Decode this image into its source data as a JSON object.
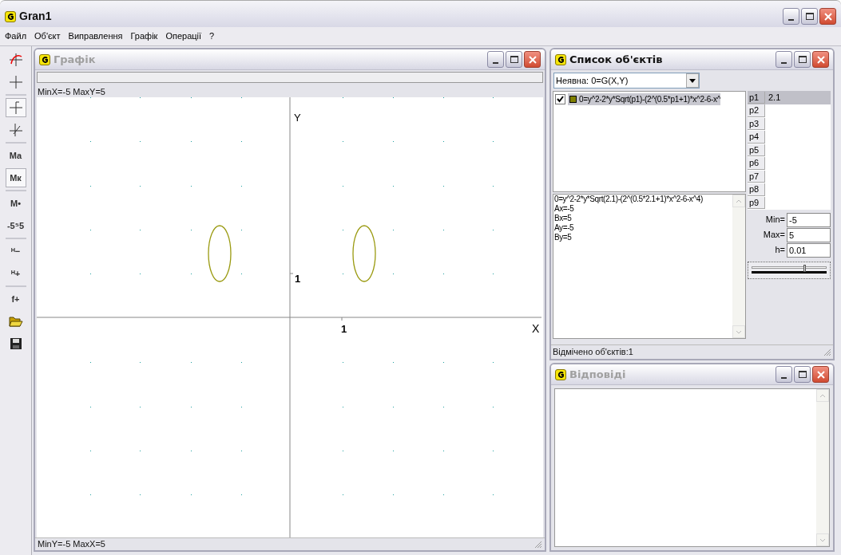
{
  "app": {
    "title": "Gran1",
    "menu": [
      "Файл",
      "Об'єкт",
      "Виправлення",
      "Графік",
      "Операції",
      "?"
    ]
  },
  "toolbar": [
    [
      {
        "kind": "axes-color",
        "selected": false
      },
      {
        "kind": "cross",
        "selected": false
      }
    ],
    [
      {
        "kind": "axes-up",
        "selected": true
      },
      {
        "kind": "axes-tilt",
        "selected": false
      }
    ],
    [
      {
        "kind": "label",
        "label": "Mа",
        "selected": false
      },
      {
        "kind": "label",
        "label": "Mк",
        "selected": true
      }
    ],
    [
      {
        "kind": "label",
        "label": "M•",
        "selected": false
      },
      {
        "kind": "label",
        "label": "-5⁵5",
        "selected": false
      }
    ],
    [
      {
        "kind": "label",
        "label": "ᴴ−",
        "selected": false
      },
      {
        "kind": "label",
        "label": "ᴴ+",
        "selected": false
      }
    ],
    [
      {
        "kind": "label",
        "label": "f+",
        "selected": false
      },
      {
        "kind": "open",
        "selected": false
      },
      {
        "kind": "save",
        "selected": false
      }
    ]
  ],
  "graph_window": {
    "title": "Графік",
    "active": false,
    "status_top": "MinX=-5  MaxY=5",
    "status_bottom": "MinY=-5  MaxX=5",
    "y_axis_label": "Y",
    "x_axis_label": "X",
    "y_tick_label": "1",
    "x_tick_label": "1"
  },
  "objects_window": {
    "title": "Список об'єктів",
    "active": true,
    "type_select": "Неявна: 0=G(X,Y)",
    "objects": [
      {
        "formula": "0=y^2-2*y*Sqrt(p1)-(2^(0.5*p1+1)*x^2-6-x^",
        "checked": true,
        "selected": true,
        "color": "#808000"
      }
    ],
    "details": [
      "0=y^2-2*y*Sqrt(2.1)-(2^(0.5*2.1+1)*x^2-6-x^4)",
      "Ax=-5",
      "Bx=5",
      "Ay=-5",
      "By=5"
    ],
    "params": [
      {
        "name": "p1",
        "value": "2.1",
        "selected": true
      },
      {
        "name": "p2",
        "selected": false
      },
      {
        "name": "p3",
        "selected": false
      },
      {
        "name": "p4",
        "selected": false
      },
      {
        "name": "p5",
        "selected": false
      },
      {
        "name": "p6",
        "selected": false
      },
      {
        "name": "p7",
        "selected": false
      },
      {
        "name": "p8",
        "selected": false
      },
      {
        "name": "p9",
        "selected": false
      }
    ],
    "min_label": "Min=",
    "min": "-5",
    "max_label": "Max=",
    "max": "5",
    "step_label": "h=",
    "step": "0.01",
    "slider": {
      "level": 0.72
    },
    "status": "Відмічено об'єктів:1"
  },
  "answers_window": {
    "title": "Відповіді",
    "active": false
  }
}
